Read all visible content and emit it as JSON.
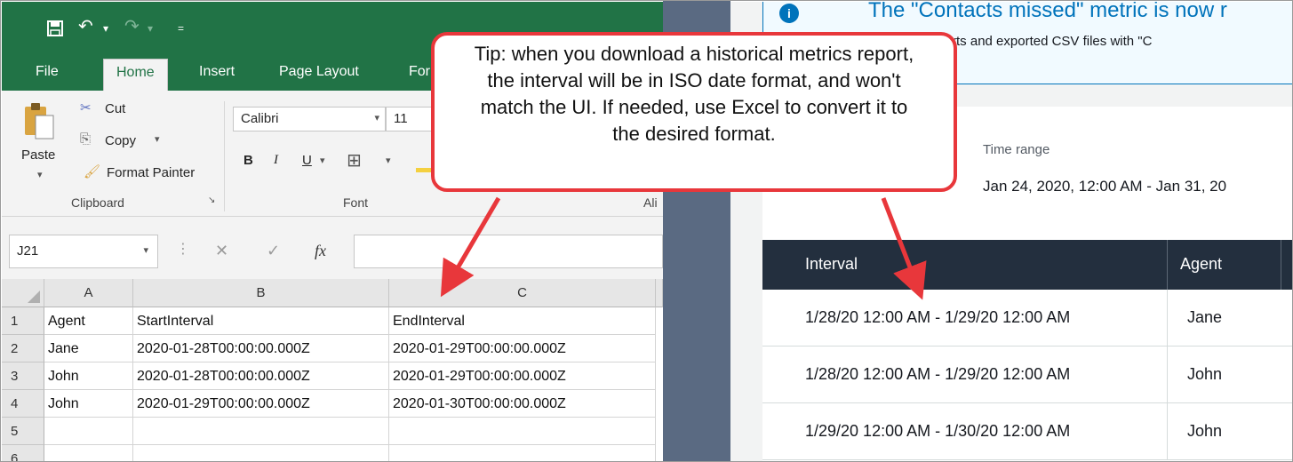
{
  "excel": {
    "tabs": [
      "File",
      "Home",
      "Insert",
      "Page Layout",
      "For"
    ],
    "clipboard": {
      "paste_label": "Paste",
      "cut_label": "Cut",
      "copy_label": "Copy",
      "format_painter_label": "Format Painter",
      "group_label": "Clipboard"
    },
    "font": {
      "font_name": "Calibri",
      "font_size": "11",
      "group_label": "Font",
      "bold": "B",
      "italic": "I",
      "underline": "U"
    },
    "alignment_group_label_partial": "Ali",
    "name_box": "J21",
    "fx_label": "fx",
    "columns": [
      "A",
      "B",
      "C"
    ],
    "rows": [
      {
        "num": "1",
        "cells": [
          "Agent",
          "StartInterval",
          "EndInterval"
        ]
      },
      {
        "num": "2",
        "cells": [
          "Jane",
          "2020-01-28T00:00:00.000Z",
          "2020-01-29T00:00:00.000Z"
        ]
      },
      {
        "num": "3",
        "cells": [
          "John",
          "2020-01-28T00:00:00.000Z",
          "2020-01-29T00:00:00.000Z"
        ]
      },
      {
        "num": "4",
        "cells": [
          "John",
          "2020-01-29T00:00:00.000Z",
          "2020-01-30T00:00:00.000Z"
        ]
      },
      {
        "num": "5",
        "cells": [
          "",
          "",
          ""
        ]
      },
      {
        "num": "6",
        "cells": [
          "",
          "",
          ""
        ]
      }
    ]
  },
  "connect": {
    "banner_title": "The \"Contacts missed\" metric is now r",
    "banner_text": "reports and exported CSV files with \"C",
    "time_range_label": "Time range",
    "time_range_value": "Jan 24, 2020, 12:00 AM - Jan 31, 20",
    "table_headers": [
      "Interval",
      "Agent"
    ],
    "table_rows": [
      {
        "interval": "1/28/20 12:00 AM - 1/29/20 12:00 AM",
        "agent": "Jane"
      },
      {
        "interval": "1/28/20 12:00 AM - 1/29/20 12:00 AM",
        "agent": "John"
      },
      {
        "interval": "1/29/20 12:00 AM - 1/30/20 12:00 AM",
        "agent": "John"
      }
    ]
  },
  "callout": {
    "text": "Tip: when you download a historical metrics report, the interval will be in ISO date format, and won't match the UI. If needed, use Excel to convert it to the desired format."
  },
  "colors": {
    "excel_green": "#217346",
    "callout_red": "#e8373b",
    "table_header_dark": "#232f3e",
    "info_blue": "#0073bb"
  }
}
